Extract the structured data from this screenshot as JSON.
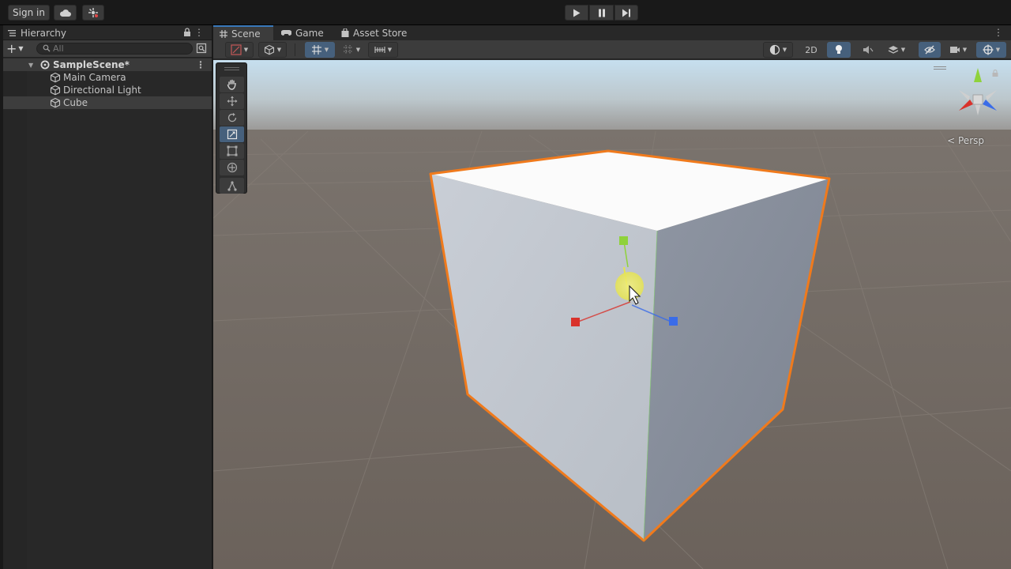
{
  "toolbar": {
    "sign_in_label": "Sign in",
    "cloud_icon": "cloud-icon",
    "collab_icon": "collaborate-icon",
    "play_icon": "play-icon",
    "pause_icon": "pause-icon",
    "step_icon": "step-icon"
  },
  "hierarchy": {
    "tab_label": "Hierarchy",
    "search_placeholder": "All",
    "scene": {
      "name": "SampleScene*",
      "items": [
        {
          "label": "Main Camera"
        },
        {
          "label": "Directional Light"
        },
        {
          "label": "Cube"
        }
      ]
    }
  },
  "scene_view": {
    "tabs": [
      {
        "label": "Scene",
        "icon": "hash-icon",
        "active": true
      },
      {
        "label": "Game",
        "icon": "gamepad-icon",
        "active": false
      },
      {
        "label": "Asset Store",
        "icon": "bag-icon",
        "active": false
      }
    ],
    "toolbar": {
      "two_d_label": "2D"
    },
    "persp_label": "Persp",
    "selected_object": "Cube",
    "active_tool": "scale-tool"
  },
  "colors": {
    "selection_outline": "#f07a1c",
    "axis_x": "#d9322b",
    "axis_y": "#8fd23b",
    "axis_z": "#3a6ce8",
    "accent": "#46607c"
  }
}
